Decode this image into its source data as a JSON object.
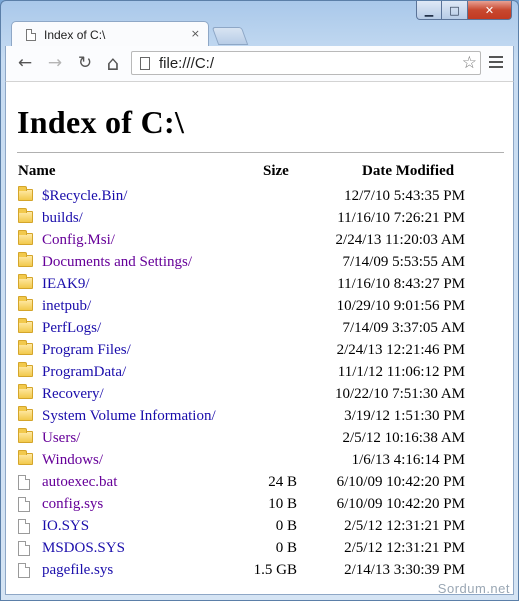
{
  "window": {
    "controls": {
      "minimize": "▁",
      "maximize": "□",
      "close": "✕"
    }
  },
  "tab": {
    "title": "Index of C:\\",
    "close": "×"
  },
  "toolbar": {
    "back_icon": "←",
    "forward_icon": "→",
    "reload_icon": "↻",
    "home_icon": "⌂",
    "url": "file:///C:/",
    "star_icon": "☆"
  },
  "page": {
    "title": "Index of C:\\",
    "columns": {
      "name": "Name",
      "size": "Size",
      "date": "Date Modified"
    },
    "entries": [
      {
        "name": "$Recycle.Bin/",
        "size": "",
        "date": "12/7/10 5:43:35 PM",
        "type": "folder",
        "visited": false
      },
      {
        "name": "builds/",
        "size": "",
        "date": "11/16/10 7:26:21 PM",
        "type": "folder",
        "visited": false
      },
      {
        "name": "Config.Msi/",
        "size": "",
        "date": "2/24/13 11:20:03 AM",
        "type": "folder",
        "visited": true
      },
      {
        "name": "Documents and Settings/",
        "size": "",
        "date": "7/14/09 5:53:55 AM",
        "type": "folder",
        "visited": true
      },
      {
        "name": "IEAK9/",
        "size": "",
        "date": "11/16/10 8:43:27 PM",
        "type": "folder",
        "visited": false
      },
      {
        "name": "inetpub/",
        "size": "",
        "date": "10/29/10 9:01:56 PM",
        "type": "folder",
        "visited": false
      },
      {
        "name": "PerfLogs/",
        "size": "",
        "date": "7/14/09 3:37:05 AM",
        "type": "folder",
        "visited": false
      },
      {
        "name": "Program Files/",
        "size": "",
        "date": "2/24/13 12:21:46 PM",
        "type": "folder",
        "visited": false
      },
      {
        "name": "ProgramData/",
        "size": "",
        "date": "11/1/12 11:06:12 PM",
        "type": "folder",
        "visited": false
      },
      {
        "name": "Recovery/",
        "size": "",
        "date": "10/22/10 7:51:30 AM",
        "type": "folder",
        "visited": false
      },
      {
        "name": "System Volume Information/",
        "size": "",
        "date": "3/19/12 1:51:30 PM",
        "type": "folder",
        "visited": false
      },
      {
        "name": "Users/",
        "size": "",
        "date": "2/5/12 10:16:38 AM",
        "type": "folder",
        "visited": true
      },
      {
        "name": "Windows/",
        "size": "",
        "date": "1/6/13 4:16:14 PM",
        "type": "folder",
        "visited": true
      },
      {
        "name": "autoexec.bat",
        "size": "24 B",
        "date": "6/10/09 10:42:20 PM",
        "type": "file",
        "visited": true
      },
      {
        "name": "config.sys",
        "size": "10 B",
        "date": "6/10/09 10:42:20 PM",
        "type": "file",
        "visited": true
      },
      {
        "name": "IO.SYS",
        "size": "0 B",
        "date": "2/5/12 12:31:21 PM",
        "type": "file",
        "visited": false
      },
      {
        "name": "MSDOS.SYS",
        "size": "0 B",
        "date": "2/5/12 12:31:21 PM",
        "type": "file",
        "visited": false
      },
      {
        "name": "pagefile.sys",
        "size": "1.5 GB",
        "date": "2/14/13 3:30:39 PM",
        "type": "file",
        "visited": false
      }
    ]
  },
  "watermark": "Sordum.net",
  "colors": {
    "link": "#1a0dab",
    "visited": "#660099",
    "folder": "#f2c94c"
  }
}
